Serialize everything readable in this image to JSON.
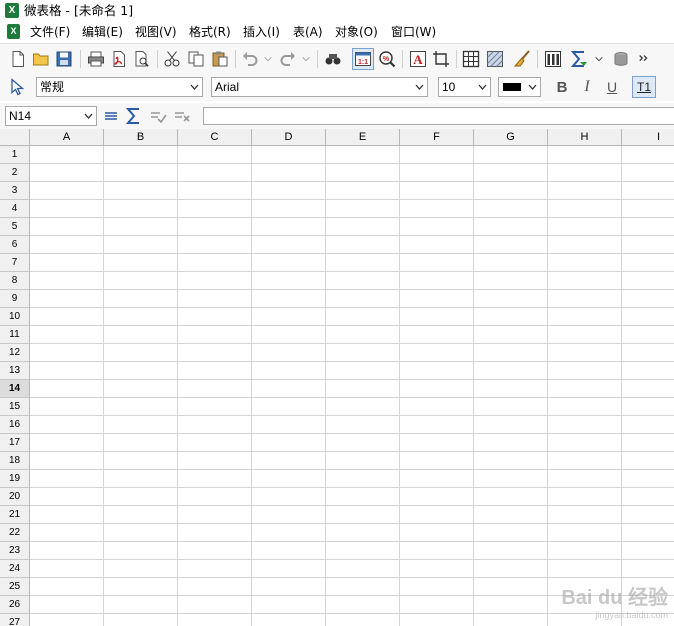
{
  "window": {
    "title": "微表格 - [未命名 1]",
    "app_icon": "X"
  },
  "menu": [
    {
      "label": "文件(F)"
    },
    {
      "label": "编辑(E)"
    },
    {
      "label": "视图(V)"
    },
    {
      "label": "格式(R)"
    },
    {
      "label": "插入(I)"
    },
    {
      "label": "表(A)"
    },
    {
      "label": "对象(O)"
    },
    {
      "label": "窗口(W)"
    }
  ],
  "toolbar1": {
    "icons": [
      "new-doc-icon",
      "open-folder-icon",
      "save-icon",
      "print-icon",
      "pdf-export-icon",
      "print-preview-icon",
      "cut-icon",
      "copy-icon",
      "paste-icon",
      "undo-icon",
      "redo-icon",
      "find-icon",
      "zoom-100-icon",
      "zoom-icon",
      "text-frame-icon",
      "crop-icon",
      "table-grid-icon",
      "pattern-fill-icon",
      "clear-format-icon",
      "column-chart-icon",
      "sum-icon",
      "database-icon",
      "more-icon"
    ],
    "zoom_label": "1:1",
    "text_frame_label": "A"
  },
  "toolbar2": {
    "style_combo": "常规",
    "font_combo": "Arial",
    "size_combo": "10",
    "color_swatch": "#000000",
    "bold_label": "B",
    "italic_label": "I",
    "underline_label": "U",
    "textwrap_label": "T1"
  },
  "formulabar": {
    "cell_ref": "N14",
    "formula_value": ""
  },
  "grid": {
    "columns": [
      "A",
      "B",
      "C",
      "D",
      "E",
      "F",
      "G",
      "H",
      "I"
    ],
    "rows": [
      "1",
      "2",
      "3",
      "4",
      "5",
      "6",
      "7",
      "8",
      "9",
      "10",
      "11",
      "12",
      "13",
      "14",
      "15",
      "16",
      "17",
      "18",
      "19",
      "20",
      "21",
      "22",
      "23",
      "24",
      "25",
      "26",
      "27"
    ],
    "active_row": "14"
  },
  "watermark": {
    "main": "Bai du 经验",
    "sub": "jingyan.baidu.com"
  },
  "colors": {
    "accent": "#1d7a3c",
    "header_bg": "#f0f0f0",
    "grid_line": "#d4d4d4"
  }
}
